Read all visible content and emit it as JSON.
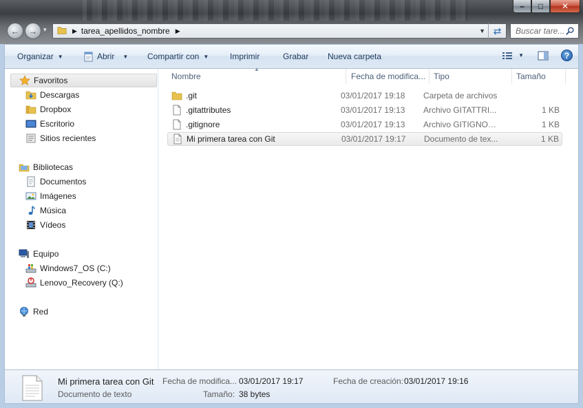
{
  "window": {
    "address": {
      "crumb": "tarea_apellidos_nombre"
    },
    "search_placeholder": "Buscar tare..."
  },
  "toolbar": {
    "organize": "Organizar",
    "open": "Abrir",
    "share": "Compartir con",
    "print": "Imprimir",
    "burn": "Grabar",
    "new_folder": "Nueva carpeta"
  },
  "nav": {
    "favorites": {
      "label": "Favoritos",
      "items": [
        "Descargas",
        "Dropbox",
        "Escritorio",
        "Sitios recientes"
      ]
    },
    "libraries": {
      "label": "Bibliotecas",
      "items": [
        "Documentos",
        "Imágenes",
        "Música",
        "Vídeos"
      ]
    },
    "computer": {
      "label": "Equipo",
      "items": [
        "Windows7_OS (C:)",
        "Lenovo_Recovery (Q:)"
      ]
    },
    "network": {
      "label": "Red"
    }
  },
  "columns": {
    "name": "Nombre",
    "date": "Fecha de modifica...",
    "type": "Tipo",
    "size": "Tamaño"
  },
  "files": [
    {
      "name": ".git",
      "date": "03/01/2017 19:18",
      "type": "Carpeta de archivos",
      "size": "",
      "icon": "folder-icon"
    },
    {
      "name": ".gitattributes",
      "date": "03/01/2017 19:13",
      "type": "Archivo GITATTRI...",
      "size": "1 KB",
      "icon": "file-icon"
    },
    {
      "name": ".gitignore",
      "date": "03/01/2017 19:13",
      "type": "Archivo GITIGNORE",
      "size": "1 KB",
      "icon": "file-icon"
    },
    {
      "name": "Mi primera tarea con Git",
      "date": "03/01/2017 19:17",
      "type": "Documento de tex...",
      "size": "1 KB",
      "icon": "text-file-icon"
    }
  ],
  "details": {
    "name": "Mi primera tarea con Git",
    "type": "Documento de texto",
    "modified_label": "Fecha de modifica...",
    "modified_value": "03/01/2017 19:17",
    "size_label": "Tamaño:",
    "size_value": "38 bytes",
    "created_label": "Fecha de creación:",
    "created_value": "03/01/2017 19:16"
  },
  "colors": {
    "toolbar_text": "#1e395b",
    "header_text": "#4c607a",
    "frame": "#b9cde5"
  }
}
